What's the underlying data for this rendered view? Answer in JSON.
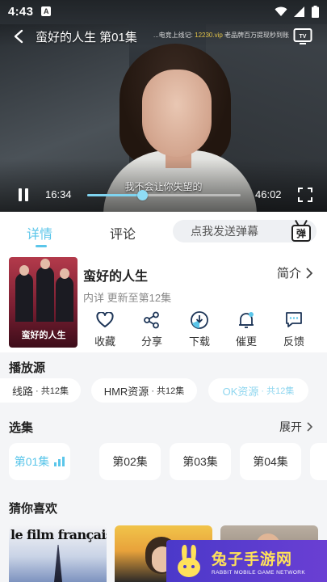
{
  "status_bar": {
    "time": "4:43",
    "notification_glyph": "A"
  },
  "player": {
    "title": "蛮好的人生 第01集",
    "marquee_prefix": "...电竞上线记: ",
    "marquee_highlight": "12230.vip",
    "marquee_suffix": " 老品牌百万提现秒到账",
    "subtitle": "我不会让你失望的",
    "current_time": "16:34",
    "total_time": "46:02",
    "progress_fraction": 0.36
  },
  "tabs": {
    "details": "详情",
    "comments": "评论"
  },
  "danmaku": {
    "placeholder": "点我发送弹幕",
    "badge": "弹"
  },
  "show": {
    "poster_title": "蛮好的人生",
    "name": "蛮好的人生",
    "intro_label": "简介",
    "meta": "内详 更新至第12集"
  },
  "actions": [
    {
      "label": "收藏",
      "icon": "heart-icon"
    },
    {
      "label": "分享",
      "icon": "share-icon"
    },
    {
      "label": "下载",
      "icon": "download-icon"
    },
    {
      "label": "催更",
      "icon": "bell-icon"
    },
    {
      "label": "反馈",
      "icon": "feedback-icon"
    }
  ],
  "sources": {
    "title": "播放源",
    "items": [
      {
        "name": "线路",
        "count": "· 共12集"
      },
      {
        "name": "HMR资源",
        "count": "· 共12集"
      },
      {
        "name": "OK资源",
        "count": "· 共12集"
      }
    ]
  },
  "episodes": {
    "title": "选集",
    "expand_label": "展开",
    "items": [
      "第01集",
      "第02集",
      "第03集",
      "第04集"
    ]
  },
  "recommend": {
    "title": "猜你喜欢",
    "rec1_text": "le film français"
  },
  "watermark": {
    "title": "兔子手游网",
    "subtitle": "RABBIT MOBILE GAME NETWORK"
  },
  "colors": {
    "accent": "#5bc6ea",
    "background": "#f4f5f7",
    "watermark": "#5a3bd0"
  }
}
